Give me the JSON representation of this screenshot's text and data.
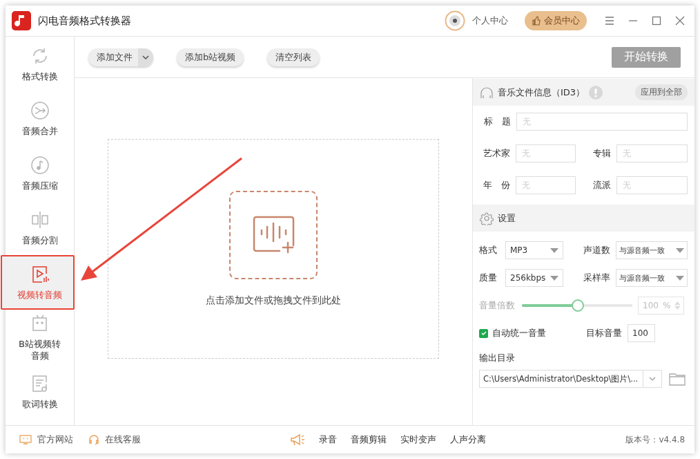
{
  "window": {
    "title": "闪电音频格式转换器",
    "user_label": "个人中心",
    "vip_button": "会员中心"
  },
  "sidebar": {
    "items": [
      {
        "kind": "refresh",
        "label": "格式转换",
        "selected": false
      },
      {
        "kind": "merge",
        "label": "音频合并",
        "selected": false
      },
      {
        "kind": "note",
        "label": "音频压缩",
        "selected": false
      },
      {
        "kind": "split",
        "label": "音频分割",
        "selected": false
      },
      {
        "kind": "video",
        "label": "视频转音频",
        "selected": true
      },
      {
        "kind": "tv",
        "label": "B站视频转音频",
        "selected": false
      },
      {
        "kind": "lyrics",
        "label": "歌词转换",
        "selected": false
      }
    ]
  },
  "toolbar": {
    "add_file": "添加文件",
    "add_bilibili": "添加b站视频",
    "clear_list": "清空列表",
    "start": "开始转换"
  },
  "drop_zone": {
    "hint": "点击添加文件或拖拽文件到此处"
  },
  "id3": {
    "title": "音乐文件信息（ID3）",
    "apply_all": "应用到全部",
    "fields": [
      {
        "label": "标　题",
        "placeholder": "无"
      },
      {
        "label": "艺术家",
        "placeholder": "无"
      },
      {
        "label": "专辑",
        "placeholder": "无"
      },
      {
        "label": "年　份",
        "placeholder": "无"
      },
      {
        "label": "流派",
        "placeholder": "无"
      }
    ]
  },
  "settings": {
    "title": "设置",
    "selects": [
      {
        "label": "格式",
        "value": "MP3"
      },
      {
        "label": "声道数",
        "value": "与源音频一致"
      },
      {
        "label": "质量",
        "value": "256kbps"
      },
      {
        "label": "采样率",
        "value": "与源音频一致"
      }
    ],
    "volume": {
      "label": "音量倍数",
      "level": 0.5,
      "value": "100",
      "unit": "%"
    },
    "auto_volume": {
      "label": "自动统一音量",
      "checked": true
    },
    "target_volume": {
      "label": "目标音量",
      "value": "100"
    },
    "output": {
      "label": "输出目录",
      "value": "C:\\Users\\Administrator\\Desktop\\图片\\..."
    }
  },
  "footer": {
    "links": [
      "官方网站",
      "在线客服"
    ],
    "tools": [
      "录音",
      "音频剪辑",
      "实时变声",
      "人声分离"
    ],
    "version": "版本号：v4.4.8"
  }
}
